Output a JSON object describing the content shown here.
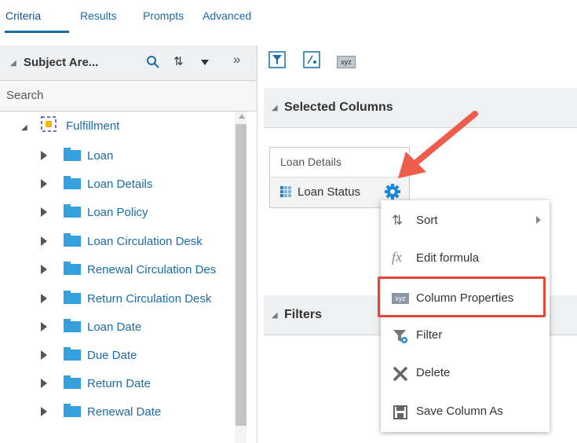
{
  "tabs": [
    {
      "label": "Criteria",
      "active": true
    },
    {
      "label": "Results",
      "active": false
    },
    {
      "label": "Prompts",
      "active": false
    },
    {
      "label": "Advanced",
      "active": false
    }
  ],
  "subject_area": {
    "title": "Subject Are...",
    "search_placeholder": "Search",
    "root": {
      "label": "Fulfillment",
      "expanded": true
    },
    "folders": [
      {
        "label": "Loan"
      },
      {
        "label": "Loan Details"
      },
      {
        "label": "Loan Policy"
      },
      {
        "label": "Loan Circulation Desk"
      },
      {
        "label": "Renewal Circulation Des"
      },
      {
        "label": "Return Circulation Desk"
      },
      {
        "label": "Loan Date"
      },
      {
        "label": "Due Date"
      },
      {
        "label": "Return Date"
      },
      {
        "label": "Renewal Date"
      }
    ]
  },
  "toolbar": {
    "icons": [
      "filter-icon",
      "formula-icon",
      "xyz-icon"
    ],
    "xyz_label": "xyz"
  },
  "selected_columns": {
    "title": "Selected Columns",
    "folder": "Loan Details",
    "column": "Loan Status"
  },
  "filters": {
    "title": "Filters"
  },
  "context_menu": {
    "items": [
      {
        "label": "Sort",
        "icon": "sort-icon",
        "has_submenu": true
      },
      {
        "label": "Edit formula",
        "icon": "fx-icon"
      },
      {
        "label": "Column Properties",
        "icon": "xyz-icon",
        "highlighted": true
      },
      {
        "label": "Filter",
        "icon": "filter-icon"
      },
      {
        "label": "Delete",
        "icon": "delete-icon"
      },
      {
        "label": "Save Column As",
        "icon": "save-icon"
      }
    ],
    "fx_glyph": "fx",
    "xyz_glyph": "xyz"
  },
  "colors": {
    "link": "#1a6ca8",
    "folder": "#34a0dd",
    "highlight": "#e5463a",
    "arrow": "#ee5d4a"
  }
}
